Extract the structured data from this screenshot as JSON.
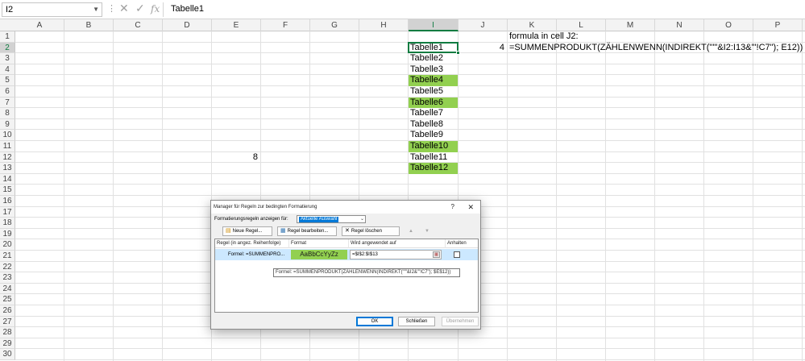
{
  "formula_bar": {
    "name_box": "I2",
    "cancel_icon": "✕",
    "enter_icon": "✓",
    "function_icon": "fx",
    "content": "Tabelle1"
  },
  "columns": [
    "A",
    "B",
    "C",
    "D",
    "E",
    "F",
    "G",
    "H",
    "I",
    "J",
    "K",
    "L",
    "M",
    "N",
    "O",
    "P"
  ],
  "rows": [
    "1",
    "2",
    "3",
    "4",
    "5",
    "6",
    "7",
    "8",
    "9",
    "10",
    "11",
    "12",
    "13",
    "14",
    "15",
    "16",
    "17",
    "18",
    "19",
    "20",
    "21",
    "22",
    "23",
    "24",
    "25",
    "26",
    "27",
    "28",
    "29",
    "30"
  ],
  "selection": {
    "column": "I",
    "row": "2"
  },
  "cells": {
    "I2": "Tabelle1",
    "I3": "Tabelle2",
    "I4": "Tabelle3",
    "I5": "Tabelle4",
    "I6": "Tabelle5",
    "I7": "Tabelle6",
    "I8": "Tabelle7",
    "I9": "Tabelle8",
    "I10": "Tabelle9",
    "I11": "Tabelle10",
    "I12": "Tabelle11",
    "I13": "Tabelle12",
    "J2": "4",
    "E12": "8",
    "K1": "formula in cell J2:",
    "K2": "=SUMMENPRODUKT(ZÄHLENWENN(INDIREKT(\"'\"&I2:I13&\"'!C7\"); E12))"
  },
  "highlight_color": "#92d050",
  "dialog": {
    "title": "Manager für Regeln zur bedingten Formatierung",
    "help": "?",
    "close": "✕",
    "show_rules_label": "Formatierungsregeln anzeigen für:",
    "scope_value": "Aktuelle Auswahl",
    "toolbar": {
      "new_rule": "Neue Regel...",
      "edit_rule": "Regel bearbeiten...",
      "delete_rule": "Regel löschen",
      "move_up": "▲",
      "move_down": "▼"
    },
    "headers": {
      "rule": "Regel (in angez. Reihenfolge)",
      "format": "Format",
      "applies_to": "Wird angewendet auf",
      "stop": "Anhalten"
    },
    "rule": {
      "formula": "Formel: =SUMMENPRO...",
      "preview": "AaBbCcYyZz",
      "applies_to": "=$I$2:$I$13"
    },
    "tooltip": "Formel: =SUMMENPRODUKT(ZÄHLENWENN(INDIREKT(\"'\"&I2&\"'!C7\"); $E$12))",
    "buttons": {
      "ok": "OK",
      "close": "Schließen",
      "apply": "Übernehmen"
    }
  }
}
